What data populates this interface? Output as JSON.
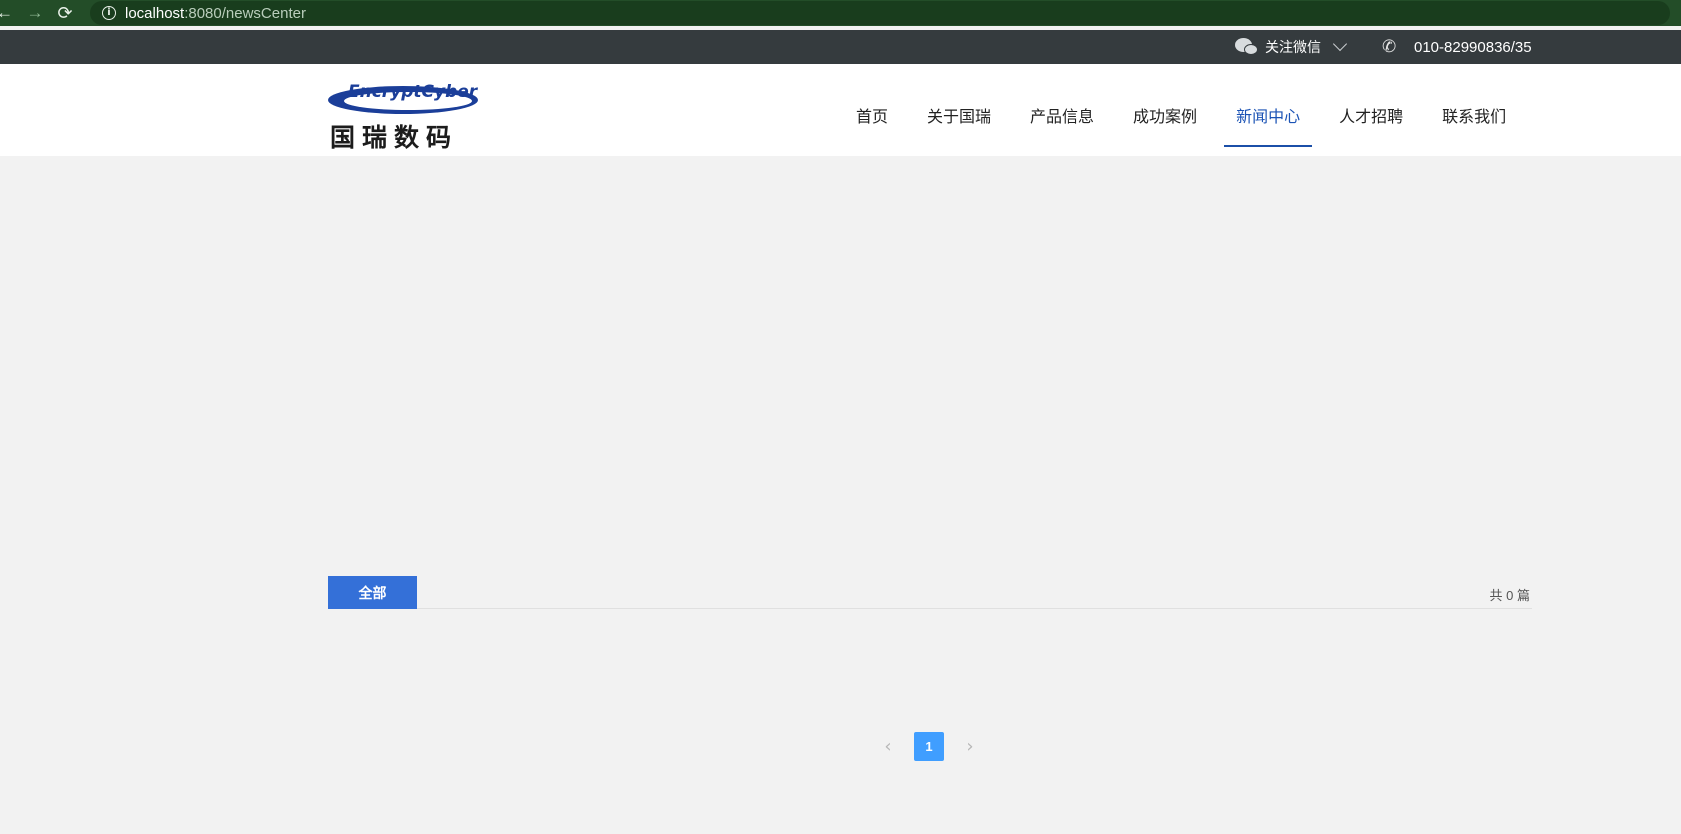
{
  "browser": {
    "url_host": "localhost",
    "url_path": ":8080/newsCenter"
  },
  "topbar": {
    "wechat_label": "关注微信",
    "phone": "010-82990836/35"
  },
  "logo": {
    "en": "EncryptCyber",
    "cn": "国瑞数码"
  },
  "menu": [
    {
      "label": "首页"
    },
    {
      "label": "关于国瑞"
    },
    {
      "label": "产品信息"
    },
    {
      "label": "成功案例"
    },
    {
      "label": "新闻中心",
      "active": true
    },
    {
      "label": "人才招聘"
    },
    {
      "label": "联系我们"
    }
  ],
  "content": {
    "tab_all": "全部",
    "count_text": "共 0 篇"
  },
  "pagination": {
    "current_page": "1",
    "prev": "‹",
    "next": "›"
  },
  "colors": {
    "accent": "#3470d8",
    "nav_active": "#1b53b5",
    "pager_active": "#409eff",
    "topbar_bg": "#353b3e"
  }
}
